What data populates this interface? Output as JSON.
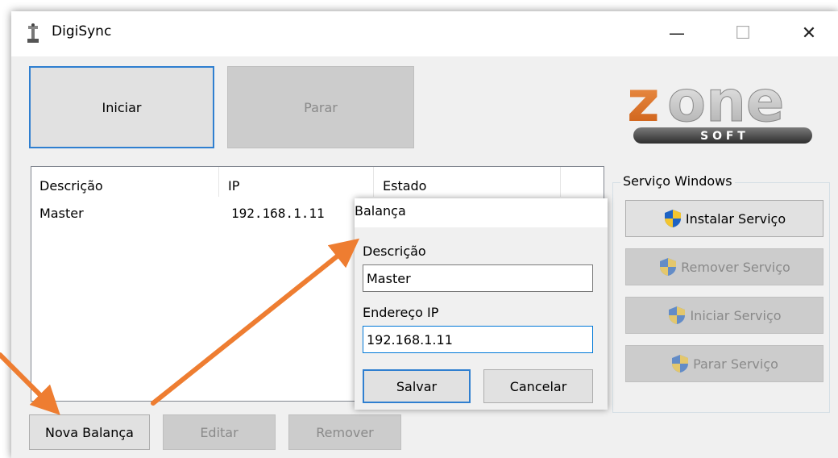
{
  "window": {
    "title": "DigiSync",
    "controls": {
      "minimize": "—",
      "maximize": "☐",
      "close": "✕"
    }
  },
  "toolbar": {
    "start_label": "Iniciar",
    "stop_label": "Parar"
  },
  "logo": {
    "text": "zone",
    "subtext": "S O F T"
  },
  "list": {
    "columns": [
      "Descrição",
      "IP",
      "Estado"
    ],
    "rows": [
      {
        "descricao": "Master",
        "ip": "192.168.1.11",
        "estado": ""
      }
    ]
  },
  "service_group": {
    "title": "Serviço Windows",
    "install_label": "Instalar Serviço",
    "remove_label": "Remover Serviço",
    "start_label": "Iniciar Serviço",
    "stop_label": "Parar Serviço"
  },
  "bottom_buttons": {
    "new_label": "Nova Balança",
    "edit_label": "Editar",
    "remove_label": "Remover"
  },
  "dialog": {
    "title": "Balança",
    "descricao_label": "Descrição",
    "descricao_value": "Master",
    "ip_label": "Endereço IP",
    "ip_value": "192.168.1.11",
    "save_label": "Salvar",
    "cancel_label": "Cancelar"
  },
  "colors": {
    "accent": "#2f7fd0",
    "annotation_arrow": "#ee7d31",
    "logo_orange": "#e8792b",
    "shield_blue": "#1e63c4",
    "shield_yellow": "#f3c52f"
  }
}
